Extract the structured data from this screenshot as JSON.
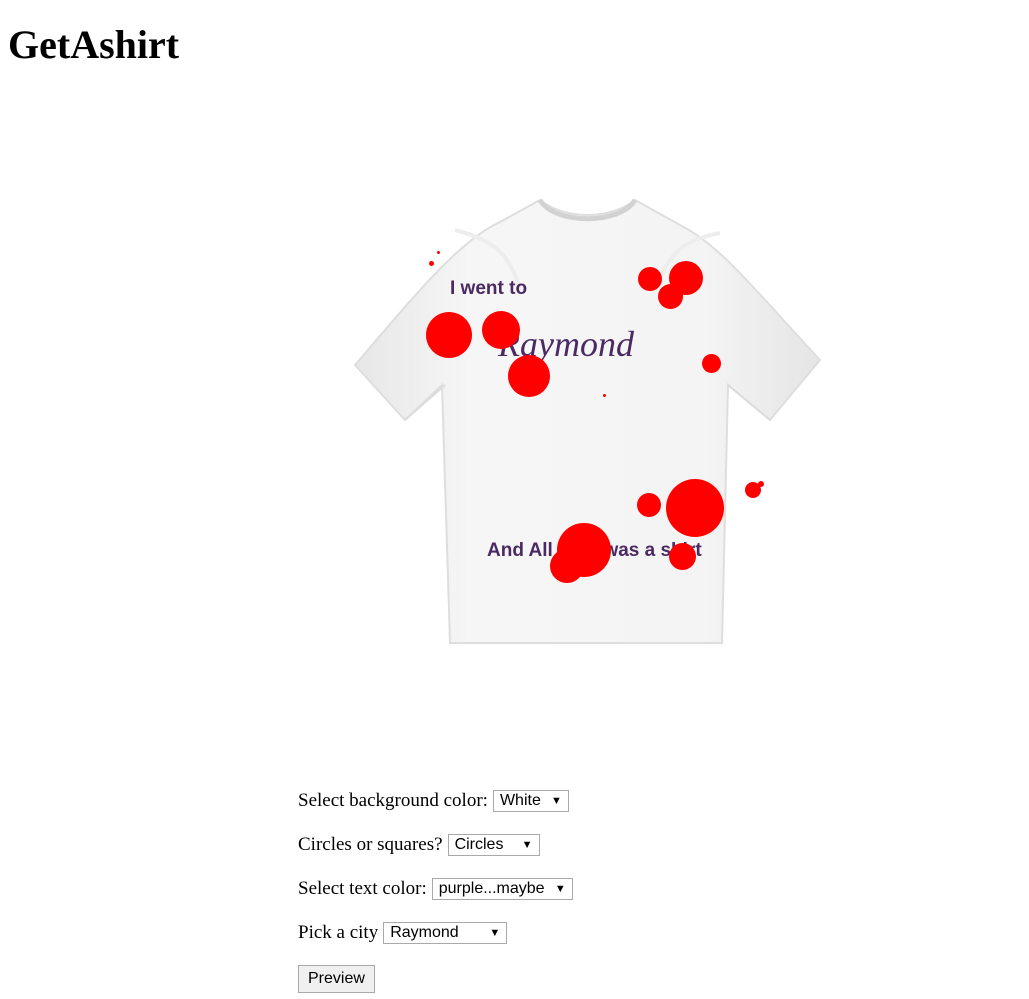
{
  "page": {
    "title": "GetAshirt"
  },
  "shirt": {
    "line1": "I went to",
    "city": "Raymond",
    "line3": "And All I got was a shirt",
    "text_color": "#4b2a63",
    "circle_color": "#ff0000",
    "shirt_color": "#f2f2f2"
  },
  "form": {
    "background": {
      "label": "Select background color:",
      "value": "White"
    },
    "shape": {
      "label": "Circles or squares?",
      "value": "Circles"
    },
    "text_color": {
      "label": "Select text color:",
      "value": "purple...maybe"
    },
    "city": {
      "label": "Pick a city",
      "value": "Raymond"
    },
    "preview": "Preview"
  }
}
